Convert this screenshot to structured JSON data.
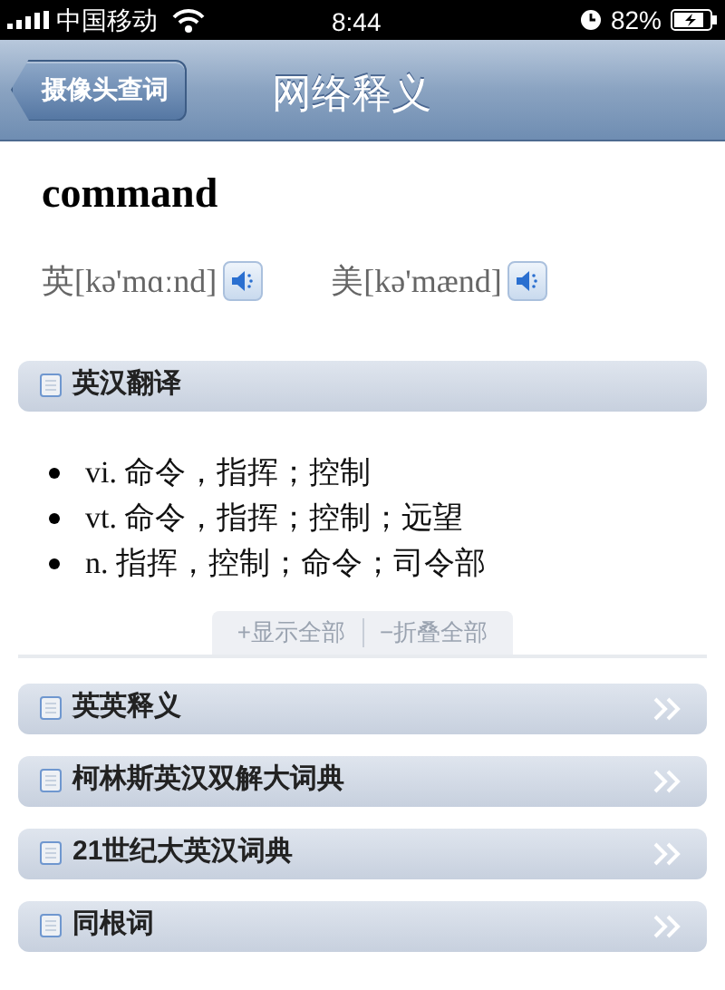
{
  "status_bar": {
    "carrier": "中国移动",
    "time": "8:44",
    "battery": "82%"
  },
  "nav": {
    "back": "摄像头查词",
    "title": "网络释义"
  },
  "word": "command",
  "pronunciations": [
    {
      "text": "英[kə'mɑːnd]"
    },
    {
      "text": "美[kə'mænd]"
    }
  ],
  "sections": [
    {
      "title": "英汉翻译",
      "expanded": true,
      "definitions": [
        "vi. 命令，指挥；控制",
        "vt. 命令，指挥；控制；远望",
        "n. 指挥，控制；命令；司令部"
      ],
      "actions": [
        "+显示全部",
        "−折叠全部"
      ]
    },
    {
      "title": "英英释义",
      "expanded": false
    },
    {
      "title": "柯林斯英汉双解大词典",
      "expanded": false
    },
    {
      "title": "21世纪大英汉词典",
      "expanded": false
    },
    {
      "title": "同根词",
      "expanded": false
    }
  ]
}
